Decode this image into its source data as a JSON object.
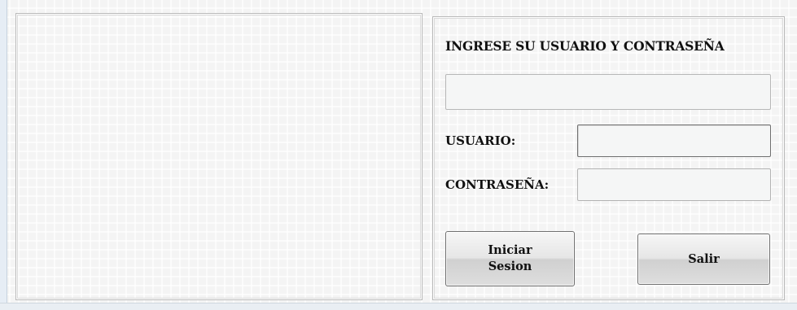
{
  "login": {
    "title": "INGRESE SU USUARIO Y CONTRASEÑA",
    "message_value": "",
    "username_label": "USUARIO:",
    "username_value": "",
    "password_label": "CONTRASEÑA:",
    "password_value": "",
    "login_button_label": "Iniciar\nSesion",
    "exit_button_label": "Salir"
  }
}
